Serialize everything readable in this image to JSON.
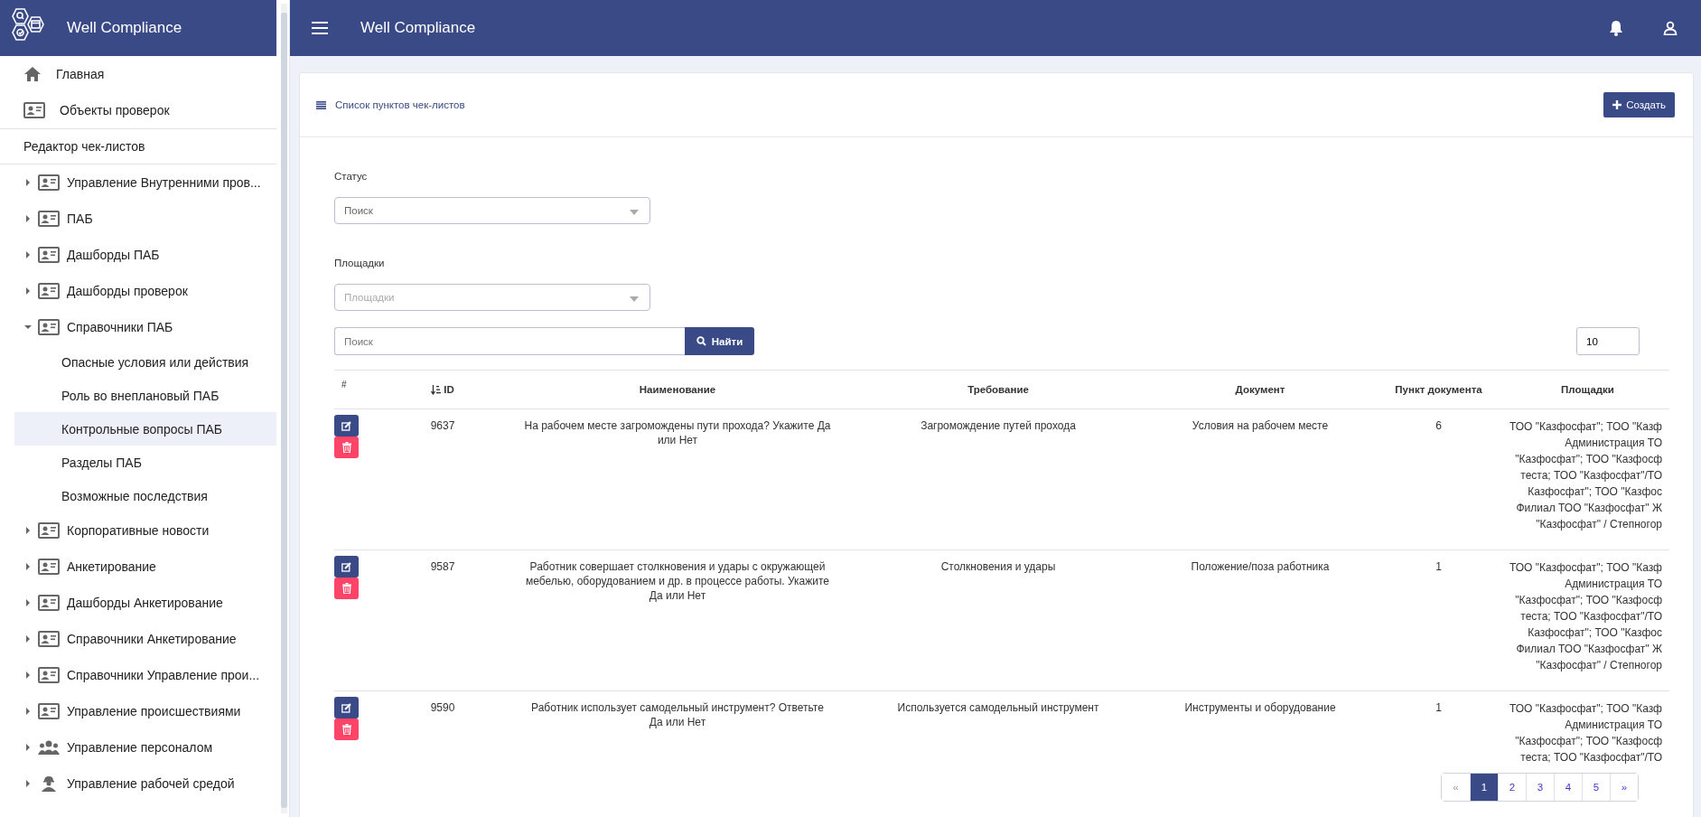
{
  "sidebar": {
    "title": "Well Compliance",
    "top_items": [
      {
        "label": "Главная",
        "kind": "home"
      },
      {
        "label": "Объекты проверок",
        "kind": "card"
      }
    ],
    "section_title": "Редактор чек-листов",
    "items": [
      {
        "label": "Управление Внутренними пров...",
        "kind": "card",
        "expanded": false
      },
      {
        "label": "ПАБ",
        "kind": "card",
        "expanded": false
      },
      {
        "label": "Дашборды ПАБ",
        "kind": "card",
        "expanded": false
      },
      {
        "label": "Дашборды проверок",
        "kind": "card",
        "expanded": false
      },
      {
        "label": "Справочники ПАБ",
        "kind": "card",
        "expanded": true,
        "children": [
          {
            "label": "Опасные условия или действия",
            "selected": false
          },
          {
            "label": "Роль во внеплановый ПАБ",
            "selected": false
          },
          {
            "label": "Контрольные вопросы ПАБ",
            "selected": true
          },
          {
            "label": "Разделы ПАБ",
            "selected": false
          },
          {
            "label": "Возможные последствия",
            "selected": false
          }
        ]
      },
      {
        "label": "Корпоративные новости",
        "kind": "card",
        "expanded": false
      },
      {
        "label": "Анкетирование",
        "kind": "card",
        "expanded": false
      },
      {
        "label": "Дашборды Анкетирование",
        "kind": "card",
        "expanded": false
      },
      {
        "label": "Справочники Анкетирование",
        "kind": "card",
        "expanded": false
      },
      {
        "label": "Справочники Управление прои...",
        "kind": "card",
        "expanded": false
      },
      {
        "label": "Управление происшествиями",
        "kind": "card",
        "expanded": false
      },
      {
        "label": "Управление персоналом",
        "kind": "people",
        "expanded": false
      },
      {
        "label": "Управление рабочей средой",
        "kind": "worker",
        "expanded": false
      }
    ]
  },
  "header": {
    "title": "Well Compliance"
  },
  "card": {
    "title": "Список пунктов чек-листов",
    "create_button": "Создать"
  },
  "filters": [
    {
      "label": "Статус",
      "placeholder": "Поиск",
      "disabled": false
    },
    {
      "label": "Площадки",
      "placeholder": "Площадки",
      "disabled": true
    }
  ],
  "search": {
    "placeholder": "Поиск",
    "button": "Найти",
    "page_size": "10"
  },
  "table": {
    "columns": [
      {
        "label": "#",
        "sortable": false
      },
      {
        "label": "ID",
        "sortable": true
      },
      {
        "label": "Наименование",
        "sortable": false
      },
      {
        "label": "Требование",
        "sortable": false
      },
      {
        "label": "Документ",
        "sortable": false
      },
      {
        "label": "Пункт документа",
        "sortable": false
      },
      {
        "label": "Площадки",
        "sortable": false
      }
    ],
    "rows": [
      {
        "id": "9637",
        "name": "На рабочем месте загромождены пути прохода? Укажите Да или Нет",
        "requirement": "Загромождение путей прохода",
        "document": "Условия на рабочем месте",
        "clause": "6",
        "areas": [
          "ТОО \"Казфосфат\"; ТОО \"Казф",
          "Администрация ТО",
          "\"Казфосфат\"; ТОО \"Казфосф",
          "теста; ТОО \"Казфосфат\"/ТО",
          "Казфосфат\"; ТОО \"Казфос",
          "Филиал ТОО \"Казфосфат\" Ж",
          "\"Казфосфат\" / Степногор"
        ]
      },
      {
        "id": "9587",
        "name": "Работник совершает столкновения и удары с окружающей мебелью, оборудованием и др. в процессе работы. Укажите Да или Нет",
        "requirement": "Столкновения и удары",
        "document": "Положение/поза работника",
        "clause": "1",
        "areas": [
          "ТОО \"Казфосфат\"; ТОО \"Казф",
          "Администрация ТО",
          "\"Казфосфат\"; ТОО \"Казфосф",
          "теста; ТОО \"Казфосфат\"/ТО",
          "Казфосфат\"; ТОО \"Казфос",
          "Филиал ТОО \"Казфосфат\" Ж",
          "\"Казфосфат\" / Степногор"
        ]
      },
      {
        "id": "9590",
        "name": "Работник использует самодельный инструмент? Ответьте Да или Нет",
        "requirement": "Используется самодельный инструмент",
        "document": "Инструменты и оборудование",
        "clause": "1",
        "areas": [
          "ТОО \"Казфосфат\"; ТОО \"Казф",
          "Администрация ТО",
          "\"Казфосфат\"; ТОО \"Казфосф",
          "теста; ТОО \"Казфосфат\"/ТО"
        ]
      }
    ]
  },
  "pagination": {
    "prev": "«",
    "next": "»",
    "pages": [
      {
        "label": "1",
        "selected": true
      },
      {
        "label": "2",
        "selected": false
      },
      {
        "label": "3",
        "selected": false
      },
      {
        "label": "4",
        "selected": false
      },
      {
        "label": "5",
        "selected": false
      }
    ]
  }
}
